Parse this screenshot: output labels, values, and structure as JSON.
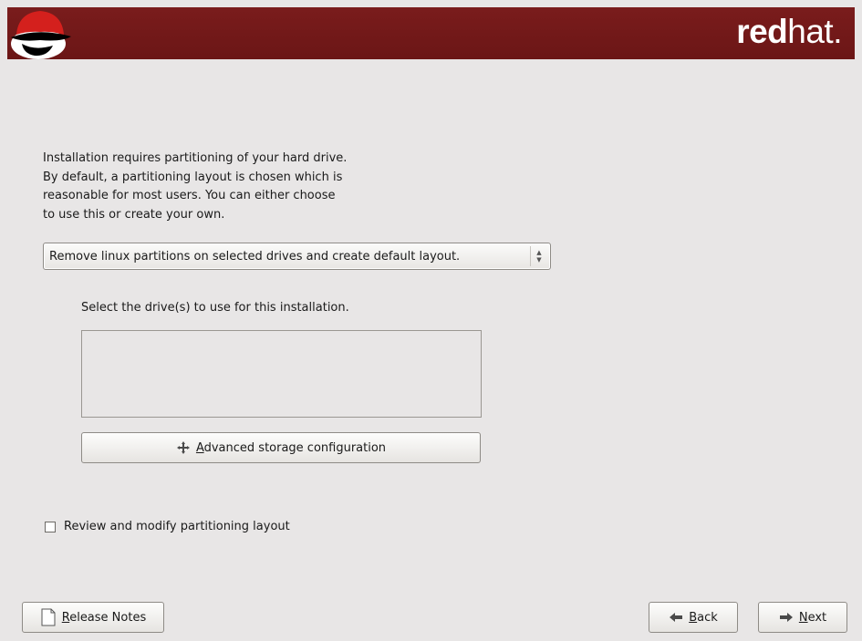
{
  "header": {
    "brand_bold": "red",
    "brand_light": "hat."
  },
  "intro_text": "Installation requires partitioning of your hard drive.\nBy default, a partitioning layout is chosen which is\nreasonable for most users.  You can either choose\nto use this or create your own.",
  "partition_select": {
    "selected": "Remove linux partitions on selected drives and create default layout."
  },
  "drives": {
    "label": "Select the drive(s) to use for this installation.",
    "items": []
  },
  "advanced_button": {
    "label": "Advanced storage configuration"
  },
  "review_checkbox": {
    "label": "Review and modify partitioning layout",
    "checked": false
  },
  "buttons": {
    "release_notes": "Release Notes",
    "back": "Back",
    "next": "Next"
  },
  "icons": {
    "logo": "shadowman-logo",
    "advanced": "add-icon",
    "release_notes": "document-icon",
    "back": "arrow-left-icon",
    "next": "arrow-right-icon"
  },
  "colors": {
    "banner": "#731a1a",
    "background": "#e8e6e6"
  }
}
